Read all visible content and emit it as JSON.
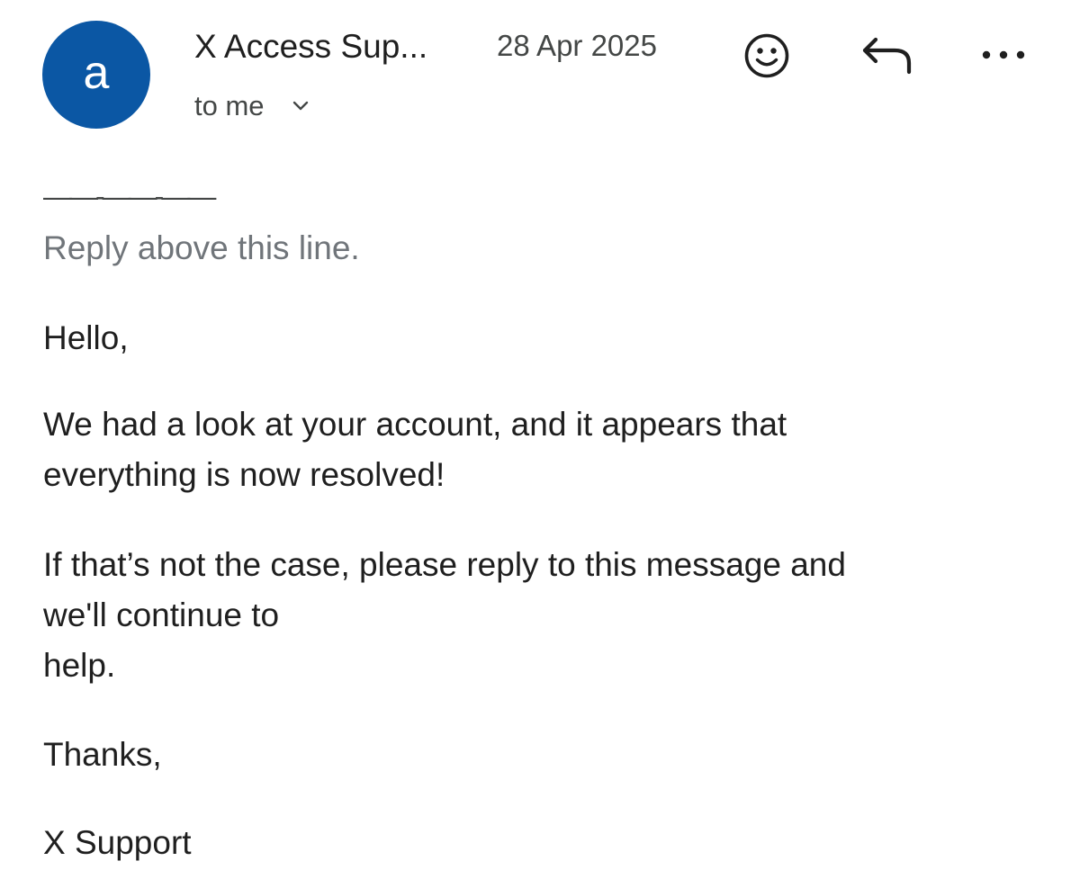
{
  "header": {
    "avatar_letter": "a",
    "avatar_color": "#0b57a4",
    "sender_name": "X Access Sup...",
    "date": "28 Apr 2025",
    "recipients_label": "to me",
    "icons": {
      "emoji": "smiley-face-icon",
      "reply": "reply-arrow-icon",
      "more": "more-options-icon",
      "expand": "chevron-down-icon"
    }
  },
  "body": {
    "divider": "——-——-——",
    "reply_hint": "Reply above this line.",
    "greeting": "Hello,",
    "paragraph1_lines": [
      "We had a look at your account, and it appears that",
      "everything is now resolved!"
    ],
    "paragraph2_lines": [
      "If that’s not the case, please reply to this message and",
      "we'll continue to",
      "help."
    ],
    "signoff": "Thanks,",
    "signature": "X Support"
  }
}
